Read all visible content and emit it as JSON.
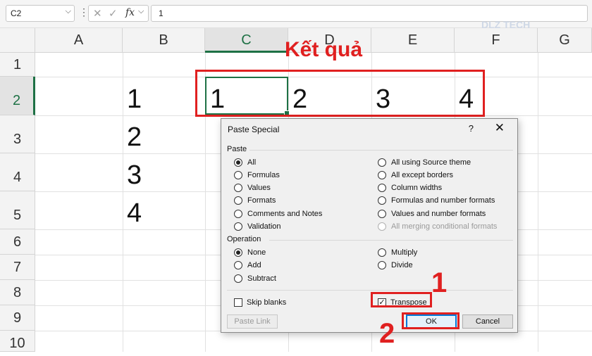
{
  "formula_bar": {
    "name_box": "C2",
    "name_box_dropdown": "⌵",
    "separator": "⋮",
    "cancel_icon": "✕",
    "enter_icon": "✓",
    "fx_label": "fx",
    "fx_dropdown": "⌵",
    "value": "1"
  },
  "columns": [
    "A",
    "B",
    "C",
    "D",
    "E",
    "F",
    "G"
  ],
  "rows": [
    "1",
    "2",
    "3",
    "4",
    "5",
    "6",
    "7",
    "8",
    "9",
    "10"
  ],
  "cells": {
    "B2": "1",
    "B3": "2",
    "B4": "3",
    "B5": "4",
    "C2": "1",
    "D2": "2",
    "E2": "3",
    "F2": "4"
  },
  "result_label": "Kết quả",
  "watermark": "DLZ TECH",
  "dialog": {
    "title": "Paste Special",
    "help": "?",
    "close": "✕",
    "paste_section": "Paste",
    "paste_options_left": [
      "All",
      "Formulas",
      "Values",
      "Formats",
      "Comments and Notes",
      "Validation"
    ],
    "paste_options_right": [
      "All using Source theme",
      "All except borders",
      "Column widths",
      "Formulas and number formats",
      "Values and number formats",
      "All merging conditional formats"
    ],
    "operation_section": "Operation",
    "operation_left": [
      "None",
      "Add",
      "Subtract"
    ],
    "operation_right": [
      "Multiply",
      "Divide"
    ],
    "skip_blanks": "Skip blanks",
    "transpose": "Transpose",
    "paste_link": "Paste Link",
    "ok": "OK",
    "cancel": "Cancel"
  },
  "steps": {
    "step1": "1",
    "step2": "2"
  },
  "colors": {
    "accent_red": "#e02020",
    "excel_green": "#1e7145",
    "ok_blue": "#0078d7"
  }
}
